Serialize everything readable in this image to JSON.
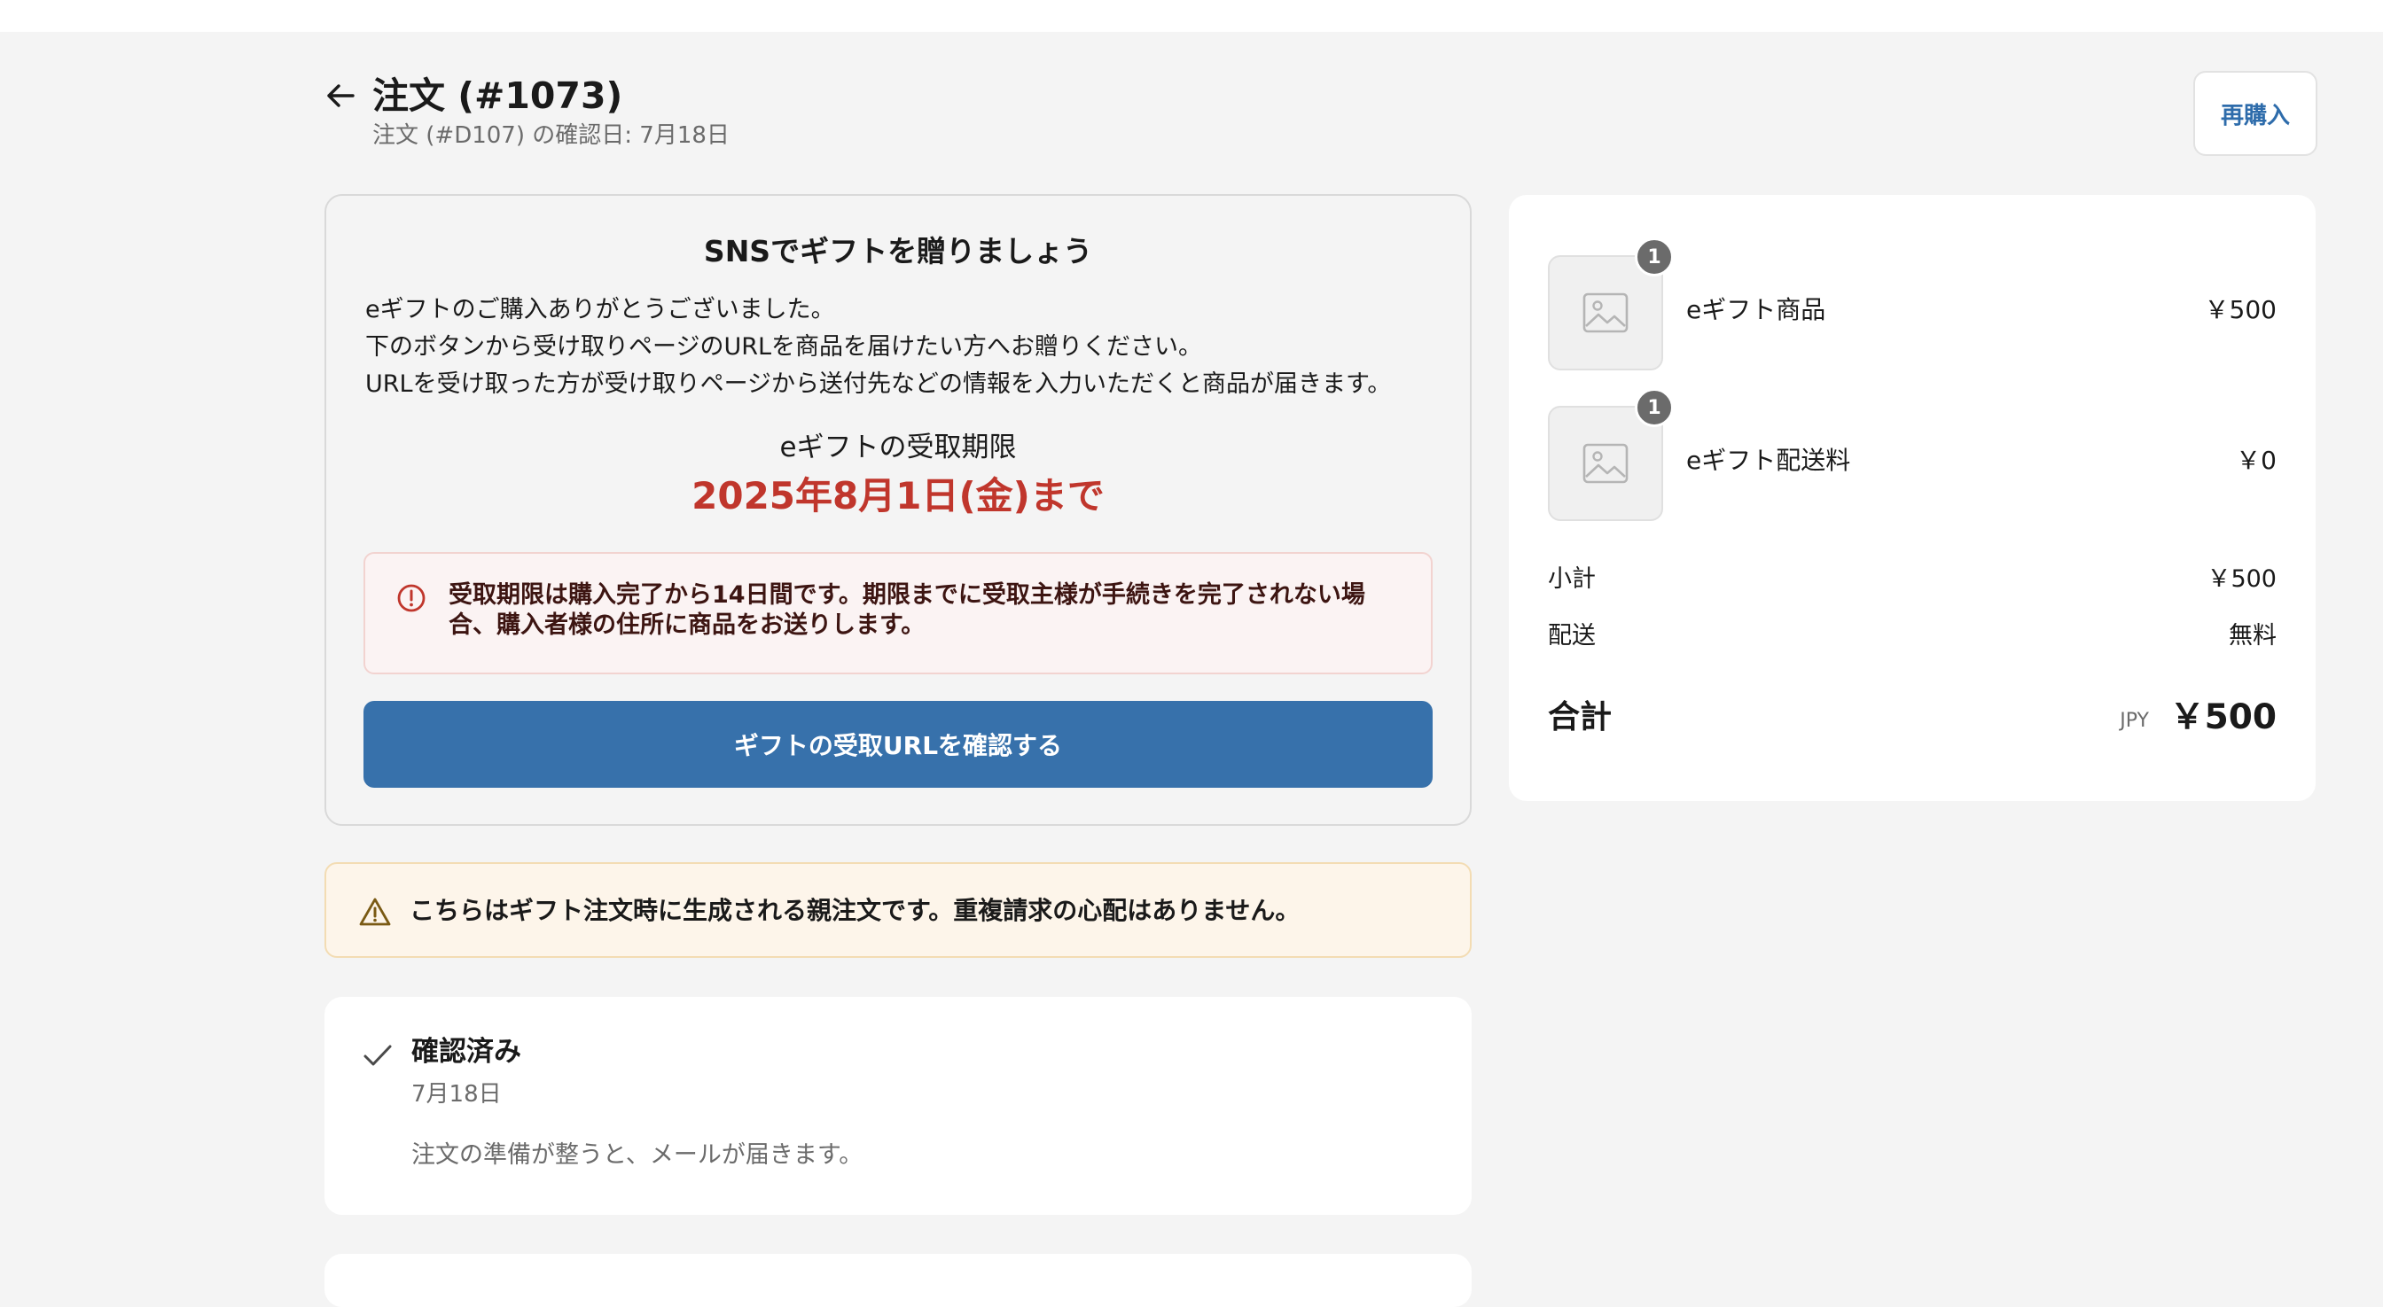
{
  "header": {
    "title": "注文 (#1073)",
    "subtitle": "注文 (#D107) の確認日: 7月18日",
    "rebuy_label": "再購入"
  },
  "gift": {
    "heading": "SNSでギフトを贈りましょう",
    "body": [
      "eギフトのご購入ありがとうございました。",
      "下のボタンから受け取りページのURLを商品を届けたい方へお贈りください。",
      "URLを受け取った方が受け取りページから送付先などの情報を入力いただくと商品が届きます。"
    ],
    "deadline_label": "eギフトの受取期限",
    "deadline_date": "2025年8月1日(金)まで",
    "notice": "受取期限は購入完了から14日間です。期限までに受取主様が手続きを完了されない場合、購入者様の住所に商品をお送りします。",
    "button_label": "ギフトの受取URLを確認する"
  },
  "parent_notice": "こちらはギフト注文時に生成される親注文です。重複請求の心配はありません。",
  "status": {
    "title": "確認済み",
    "date": "7月18日",
    "message": "注文の準備が整うと、メールが届きます。"
  },
  "summary": {
    "items": [
      {
        "name": "eギフト商品",
        "price": "￥500",
        "quantity": "1"
      },
      {
        "name": "eギフト配送料",
        "price": "￥0",
        "quantity": "1"
      }
    ],
    "subtotal_label": "小計",
    "subtotal_value": "￥500",
    "shipping_label": "配送",
    "shipping_value": "無料",
    "total_label": "合計",
    "total_currency": "JPY",
    "total_value": "￥500"
  },
  "colors": {
    "accent": "#3771ab",
    "deadline": "#c0362c",
    "link": "#2e6cab"
  }
}
